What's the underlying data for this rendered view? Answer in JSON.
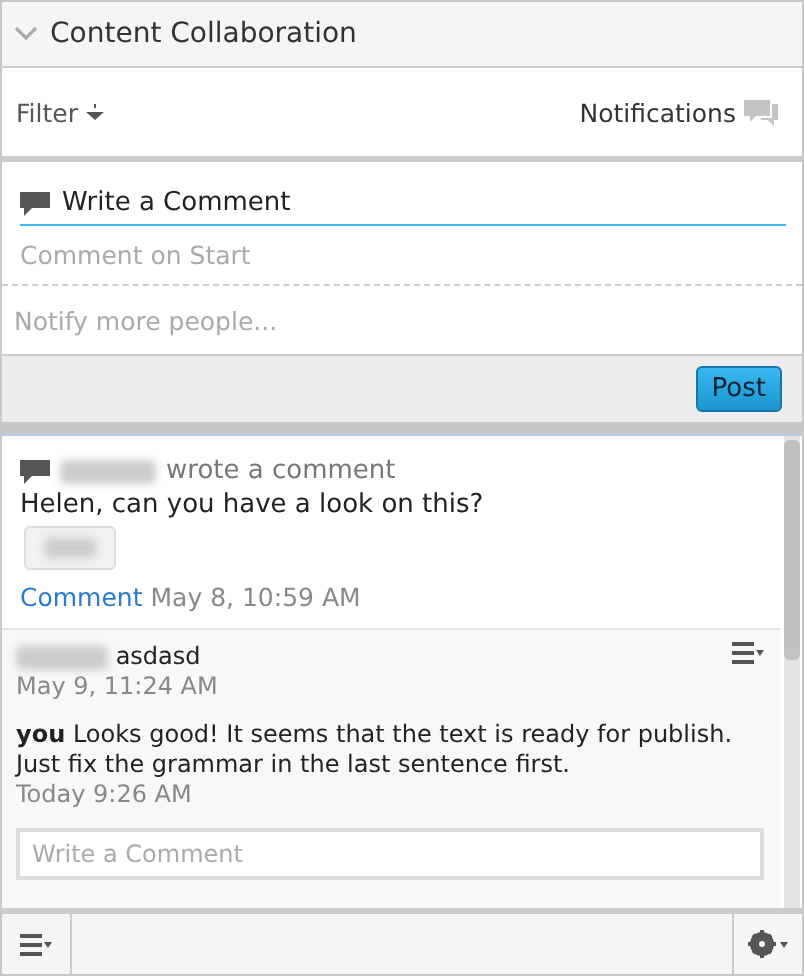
{
  "panel": {
    "title": "Content Collaboration",
    "expanded": true
  },
  "toolbar": {
    "filter": "Filter",
    "notifications": "Notifications"
  },
  "composer": {
    "title": "Write a Comment",
    "placeholder": "Comment on Start",
    "notify_placeholder": "Notify more people...",
    "post": "Post"
  },
  "activity": {
    "action": "wrote a comment",
    "text": "Helen, can you have a look on this?",
    "link": "Comment",
    "time": "May 8, 10:59 AM"
  },
  "replies": [
    {
      "text": "asdasd",
      "time": "May 9, 11:24 AM",
      "menu": true
    },
    {
      "author": "you",
      "text": "Looks good! It seems that the text is ready for publish. Just fix the grammar in the last sentence first.",
      "time": "Today 9:26 AM"
    }
  ],
  "reply_placeholder": "Write a Comment"
}
